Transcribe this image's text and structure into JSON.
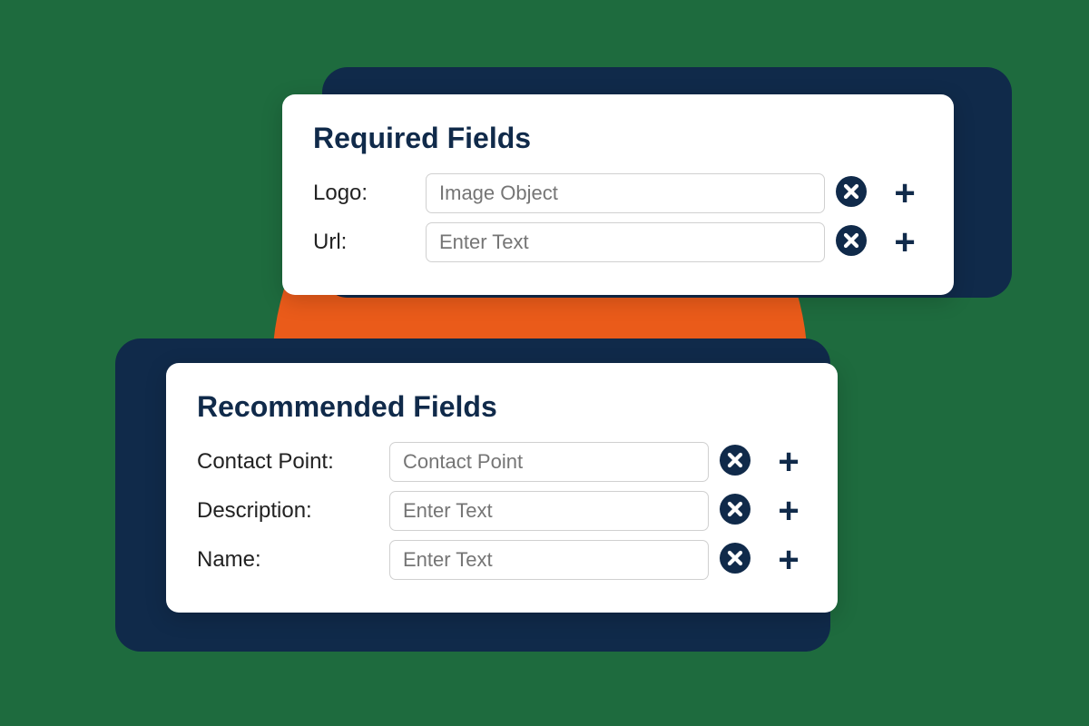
{
  "colors": {
    "accent_orange": "#ea5b1a",
    "dark_navy": "#102a4a",
    "heading": "#102a4a"
  },
  "cards": {
    "required": {
      "title": "Required Fields",
      "rows": [
        {
          "label": "Logo:",
          "placeholder": "Image Object"
        },
        {
          "label": "Url:",
          "placeholder": "Enter Text"
        }
      ]
    },
    "recommended": {
      "title": "Recommended Fields",
      "rows": [
        {
          "label": "Contact Point:",
          "placeholder": "Contact Point"
        },
        {
          "label": "Description:",
          "placeholder": "Enter Text"
        },
        {
          "label": "Name:",
          "placeholder": "Enter Text"
        }
      ]
    }
  }
}
